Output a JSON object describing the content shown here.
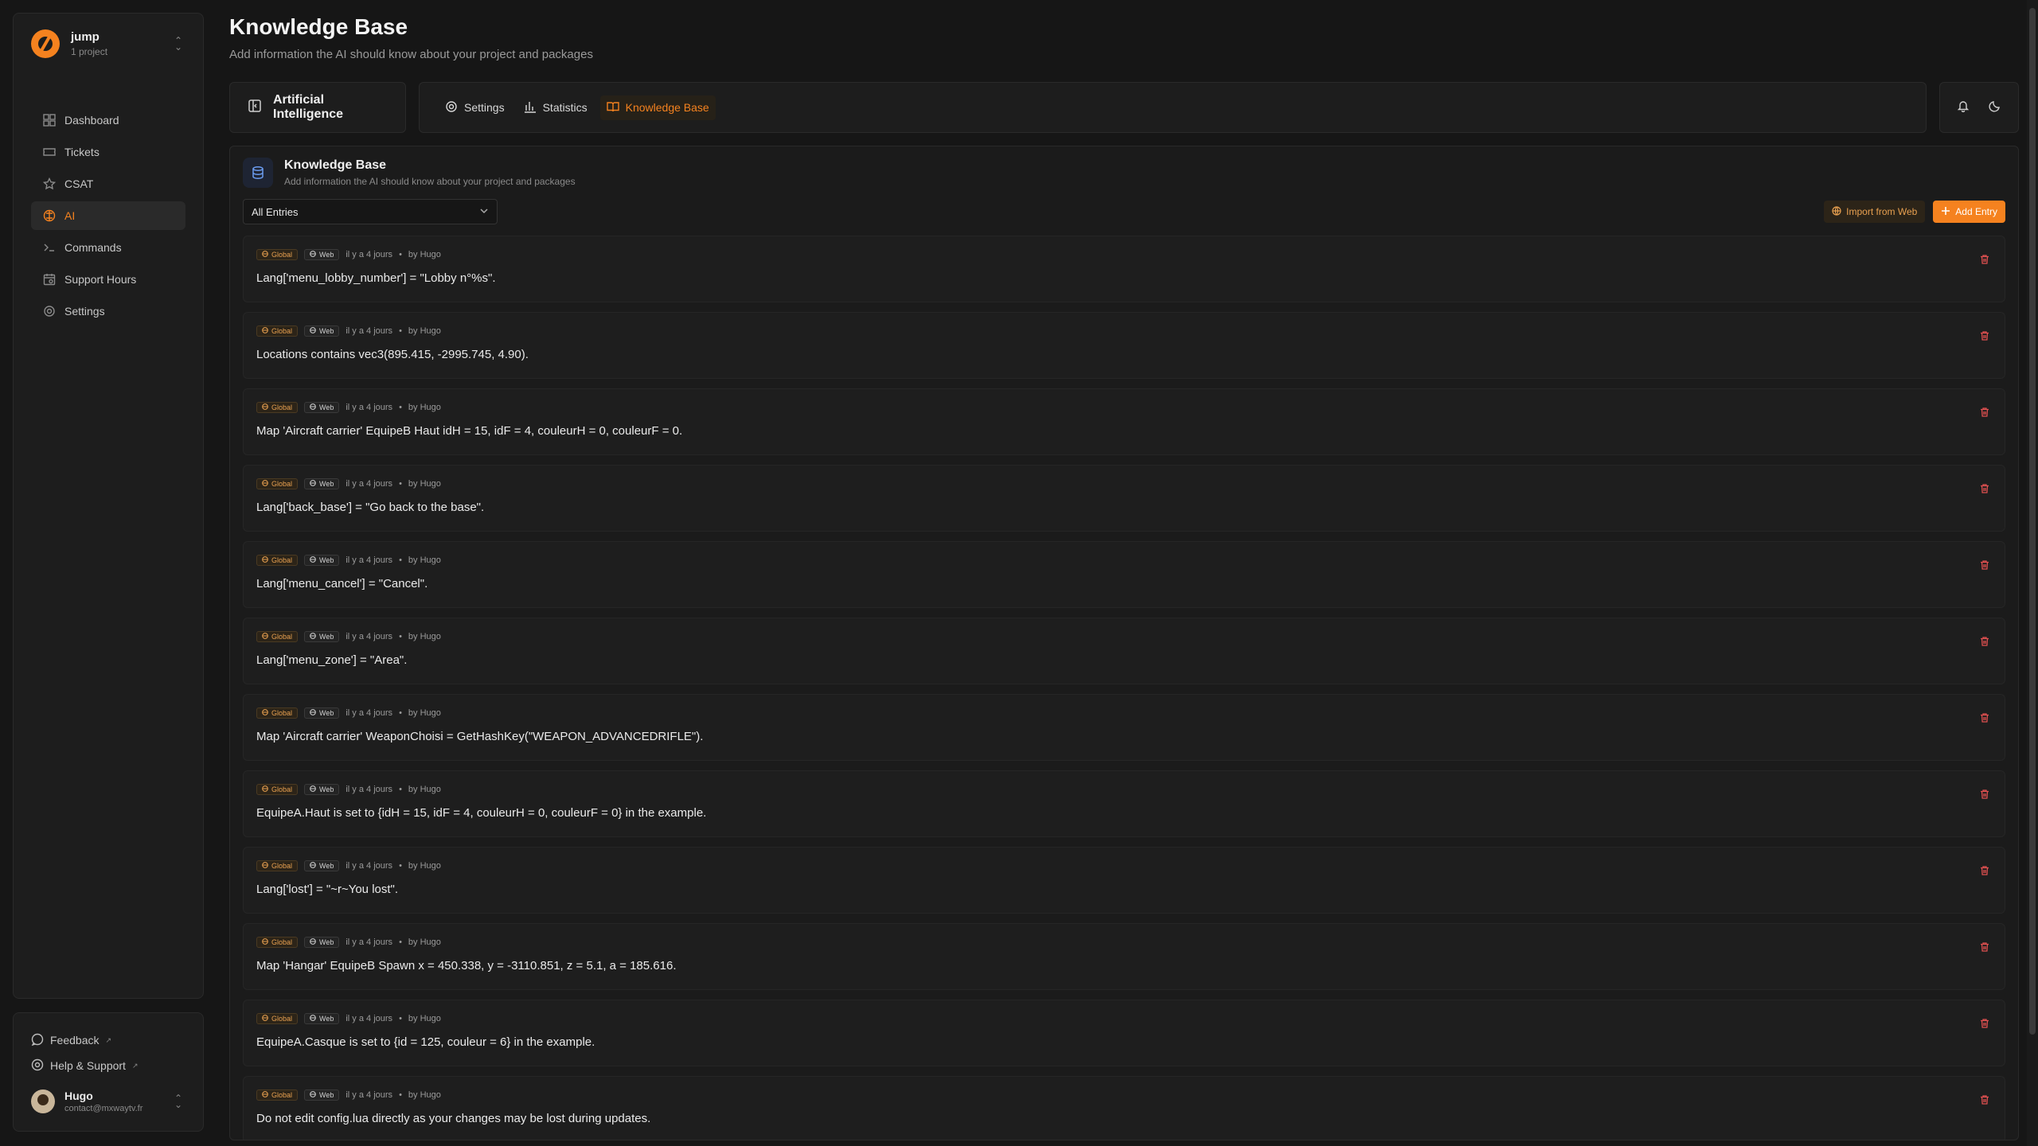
{
  "project": {
    "name": "jump",
    "subtitle": "1 project"
  },
  "nav": [
    {
      "label": "Dashboard",
      "icon": "dashboard-icon",
      "active": false
    },
    {
      "label": "Tickets",
      "icon": "ticket-icon",
      "active": false
    },
    {
      "label": "CSAT",
      "icon": "star-icon",
      "active": false
    },
    {
      "label": "AI",
      "icon": "ai-icon",
      "active": true
    },
    {
      "label": "Commands",
      "icon": "terminal-icon",
      "active": false
    },
    {
      "label": "Support Hours",
      "icon": "calendar-clock-icon",
      "active": false
    },
    {
      "label": "Settings",
      "icon": "gear-icon",
      "active": false
    }
  ],
  "footer": {
    "feedback": "Feedback",
    "help": "Help & Support",
    "external_mark": "↗",
    "user_name": "Hugo",
    "user_email": "contact@mxwaytv.fr"
  },
  "header": {
    "title": "Knowledge Base",
    "subtitle": "Add information the AI should know about your project and packages"
  },
  "section": {
    "label": "Artificial Intelligence"
  },
  "tabs": [
    {
      "label": "Settings",
      "icon": "gear-icon",
      "active": false
    },
    {
      "label": "Statistics",
      "icon": "bar-chart-icon",
      "active": false
    },
    {
      "label": "Knowledge Base",
      "icon": "book-icon",
      "active": true
    }
  ],
  "panel": {
    "title": "Knowledge Base",
    "subtitle": "Add information the AI should know about your project and packages",
    "filter_value": "All Entries",
    "import_label": "Import from Web",
    "add_label": "Add Entry"
  },
  "entry_meta": {
    "scope": "Global",
    "source": "Web",
    "time": "il y a 4 jours",
    "separator": "•",
    "author": "by Hugo"
  },
  "entries": [
    {
      "text": "Lang['menu_lobby_number'] = \"Lobby n°%s\"."
    },
    {
      "text": "Locations contains vec3(895.415, -2995.745, 4.90)."
    },
    {
      "text": "Map 'Aircraft carrier' EquipeB Haut idH = 15, idF = 4, couleurH = 0, couleurF = 0."
    },
    {
      "text": "Lang['back_base'] = \"Go back to the base\"."
    },
    {
      "text": "Lang['menu_cancel'] = \"Cancel\"."
    },
    {
      "text": "Lang['menu_zone'] = \"Area\"."
    },
    {
      "text": "Map 'Aircraft carrier' WeaponChoisi = GetHashKey(\"WEAPON_ADVANCEDRIFLE\")."
    },
    {
      "text": "EquipeA.Haut is set to {idH = 15, idF = 4, couleurH = 0, couleurF = 0} in the example."
    },
    {
      "text": "Lang['lost'] = \"~r~You lost\"."
    },
    {
      "text": "Map 'Hangar' EquipeB Spawn x = 450.338, y = -3110.851, z = 5.1, a = 185.616."
    },
    {
      "text": "EquipeA.Casque is set to {id = 125, couleur = 6} in the example."
    },
    {
      "text": "Do not edit config.lua directly as your changes may be lost during updates."
    }
  ],
  "colors": {
    "accent": "#f5821f",
    "danger": "#e05050",
    "background": "#161616"
  }
}
